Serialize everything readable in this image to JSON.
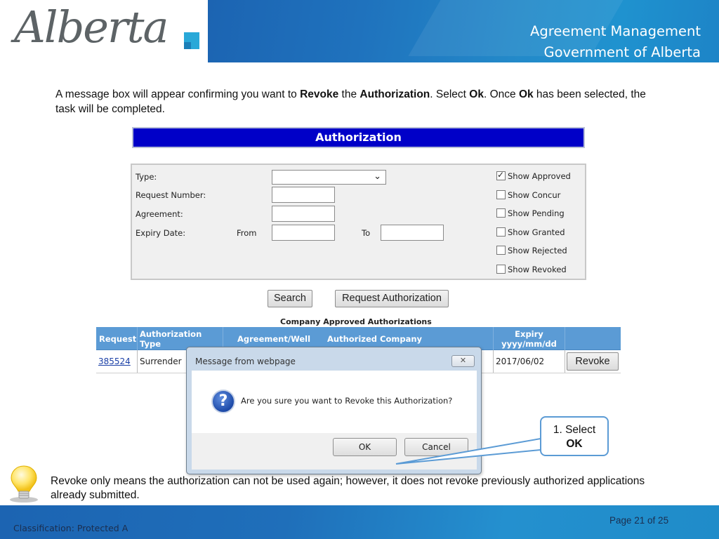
{
  "header": {
    "logo_text": "Alberta",
    "title_line1": "Agreement Management",
    "title_line2": "Government of Alberta"
  },
  "instruction": {
    "parts": [
      {
        "text": "A message box will appear confirming you want to ",
        "bold": false
      },
      {
        "text": "Revoke",
        "bold": true
      },
      {
        "text": " the ",
        "bold": false
      },
      {
        "text": "Authorization",
        "bold": true
      },
      {
        "text": ".  Select ",
        "bold": false
      },
      {
        "text": "Ok",
        "bold": true
      },
      {
        "text": ".  Once ",
        "bold": false
      },
      {
        "text": "Ok",
        "bold": true
      },
      {
        "text": " has been selected, the task will be completed.",
        "bold": false
      }
    ]
  },
  "app": {
    "title": "Authorization",
    "search": {
      "type_label": "Type:",
      "type_value": "",
      "request_number_label": "Request Number:",
      "request_number_value": "",
      "agreement_label": "Agreement:",
      "agreement_value": "",
      "expiry_label": "Expiry Date:",
      "from_label": "From",
      "from_value": "",
      "to_label": "To",
      "to_value": "",
      "filters": [
        {
          "label": "Show Approved",
          "checked": true
        },
        {
          "label": "Show Concur",
          "checked": false
        },
        {
          "label": "Show Pending",
          "checked": false
        },
        {
          "label": "Show Granted",
          "checked": false
        },
        {
          "label": "Show Rejected",
          "checked": false
        },
        {
          "label": "Show Revoked",
          "checked": false
        }
      ]
    },
    "buttons": {
      "search": "Search",
      "request_authorization": "Request Authorization"
    },
    "table": {
      "caption": "Company Approved Authorizations",
      "headers": {
        "request": "Request",
        "auth_type_1": "Authorization",
        "auth_type_2": "Type",
        "agreement_well": "Agreement/Well",
        "authorized_company": "Authorized Company",
        "expiry_1": "Expiry",
        "expiry_2": "yyyy/mm/dd"
      },
      "rows": [
        {
          "request": "385524",
          "type": "Surrender",
          "agreement_well": "",
          "company": "",
          "expiry": "2017/06/02",
          "action": "Revoke"
        }
      ]
    }
  },
  "dialog": {
    "title": "Message from webpage",
    "close_glyph": "✕",
    "message": "Are you sure you want to Revoke this Authorization?",
    "ok_label": "OK",
    "cancel_label": "Cancel"
  },
  "callout": {
    "line1": "1. Select",
    "line2": "OK"
  },
  "tip": {
    "text": "Revoke only means the authorization can not be used again; however, it does not revoke previously authorized applications already submitted."
  },
  "footer": {
    "classification": "Classification: Protected A",
    "page": "Page 21 of 25"
  },
  "colors": {
    "app_title_bg": "#0000c8",
    "table_header_bg": "#5b9bd5",
    "callout_border": "#5b9bd5",
    "brand_blue": "#1f72bd"
  }
}
